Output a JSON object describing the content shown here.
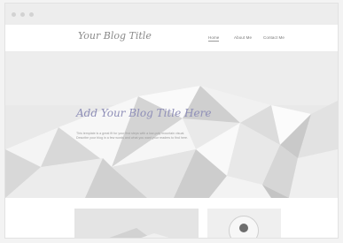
{
  "window": {
    "controls": [
      "close-dot",
      "minimize-dot",
      "maximize-dot"
    ]
  },
  "navbar": {
    "blog_title": "Your Blog Title",
    "items": [
      {
        "label": "Home",
        "active": true
      },
      {
        "label": "About Me",
        "active": false
      },
      {
        "label": "Contact Me",
        "active": false
      }
    ]
  },
  "hero": {
    "heading": "Add Your Blog Title Here",
    "text": "This template is a great fit for your first steps with a low-poly mountain visual. Describe your blog in a few words and what you want your readers to find here."
  },
  "content": {
    "image_card_icon": "mountain-image",
    "profile_icon": "user-avatar-icon"
  },
  "colors": {
    "accent_heading": "#8f8fb8",
    "title_gray": "#8a8a8a"
  }
}
